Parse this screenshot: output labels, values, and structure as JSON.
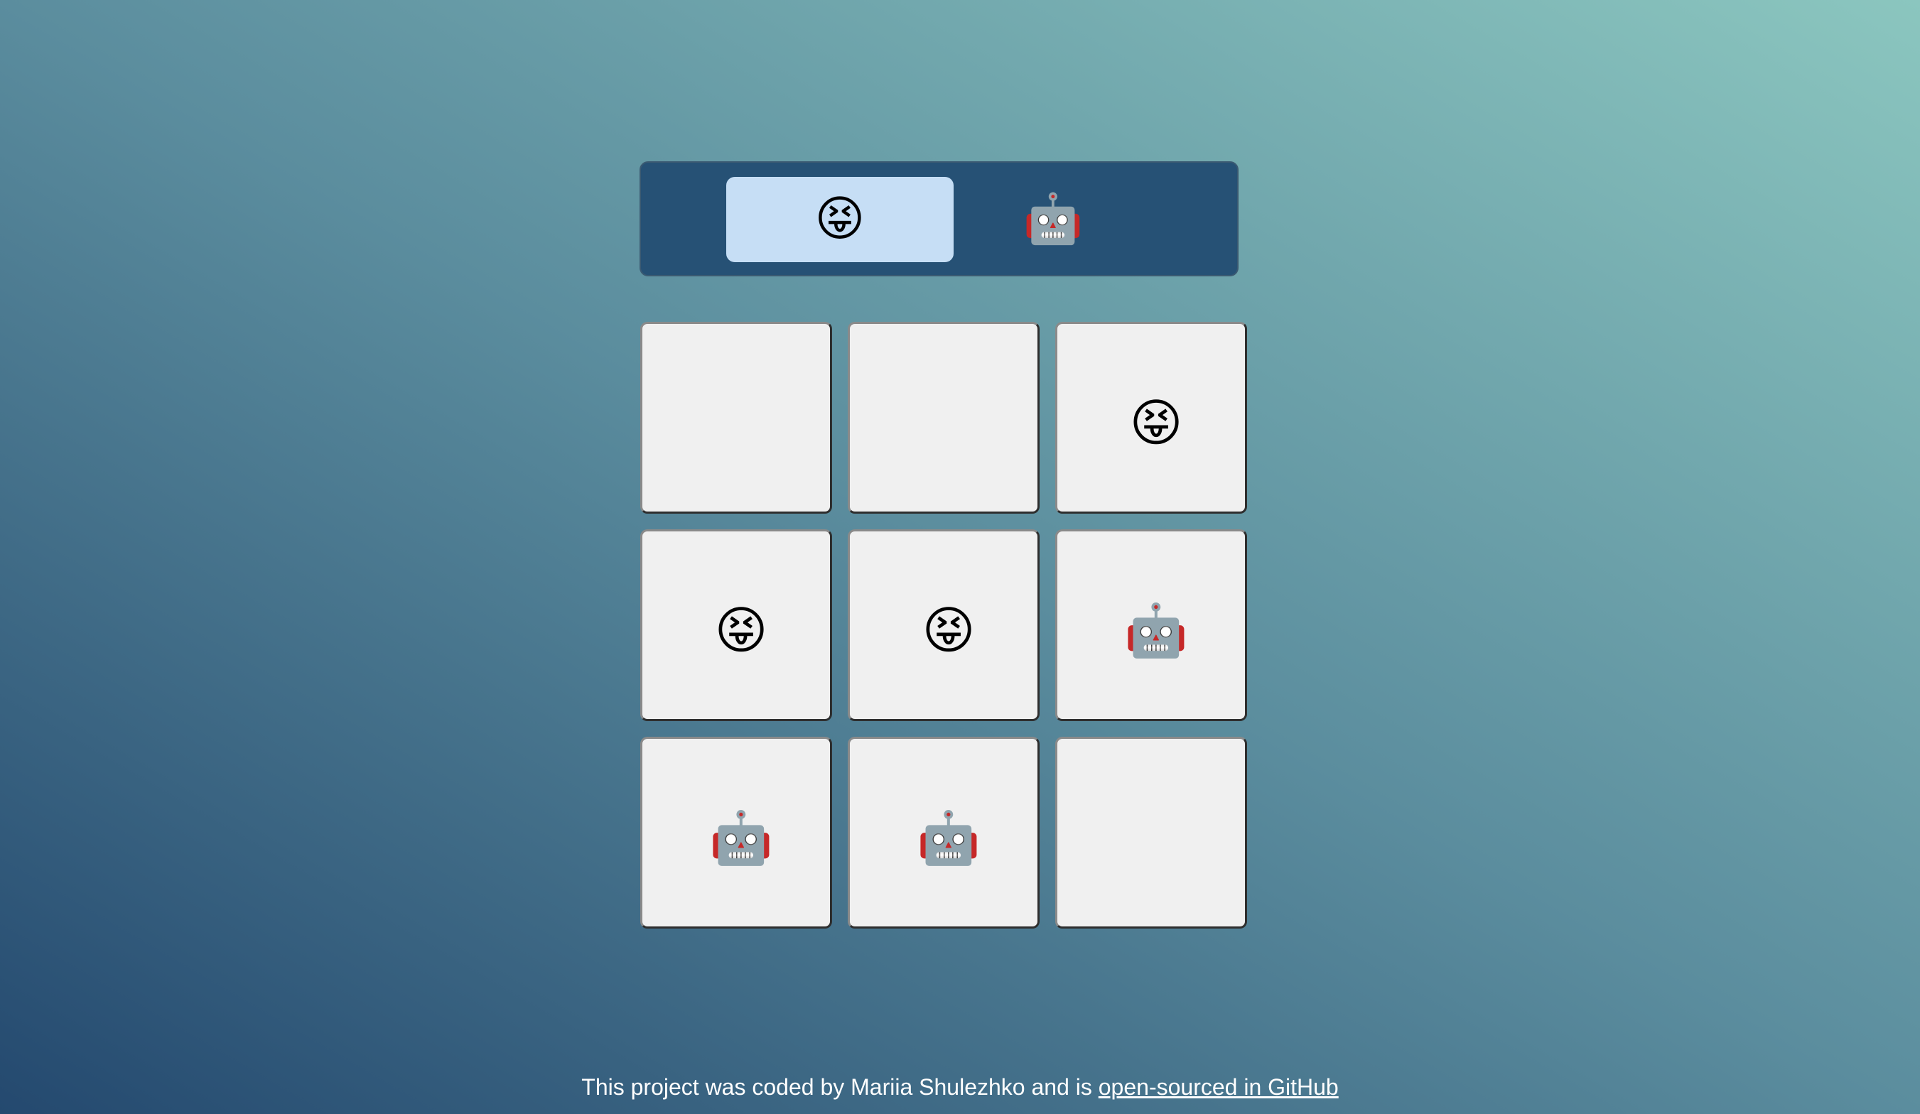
{
  "turn_indicator": {
    "players": [
      {
        "symbol": "😝",
        "active": true
      },
      {
        "symbol": "🤖",
        "active": false
      }
    ]
  },
  "board": {
    "cells": [
      "",
      "",
      "😝",
      "😝",
      "😝",
      "🤖",
      "🤖",
      "🤖",
      ""
    ]
  },
  "footer": {
    "text": "This project was coded by Mariia Shulezhko and is ",
    "link_text": "open-sourced in GitHub"
  },
  "colors": {
    "turn_bar_bg": "#265175",
    "active_slot_bg": "#c6def5",
    "cell_bg": "#f0f0f0"
  }
}
